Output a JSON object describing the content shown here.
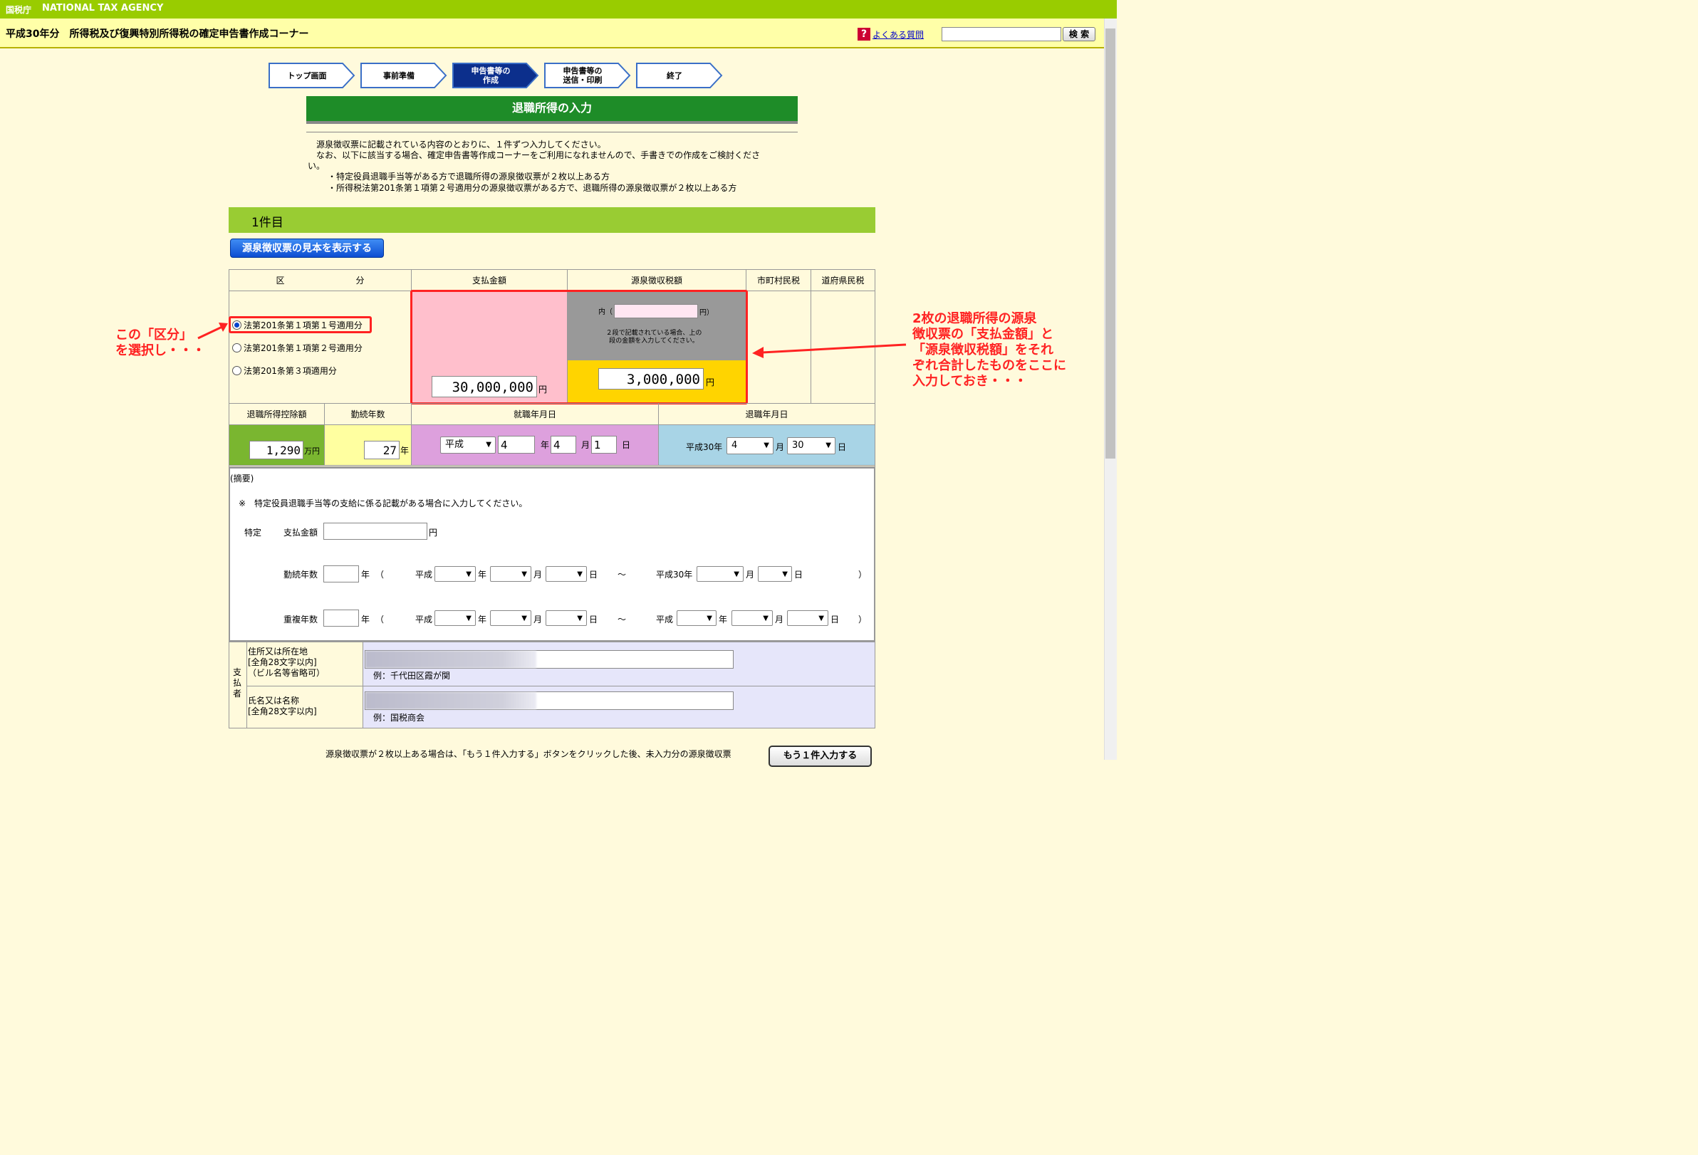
{
  "header": {
    "agency_kanji": "国税庁",
    "agency_en": "NATIONAL TAX AGENCY",
    "title": "平成30年分　所得税及び復興特別所得税の確定申告書作成コーナー",
    "faq_icon": "?",
    "faq_link": "よくある質問",
    "search_button": "検 索"
  },
  "steps": [
    {
      "label": "トップ画面"
    },
    {
      "label": "事前準備"
    },
    {
      "label": "申告書等の\n作成"
    },
    {
      "label": "申告書等の\n送信・印刷"
    },
    {
      "label": "終了"
    }
  ],
  "section_title": "退職所得の入力",
  "notes": {
    "line1": "源泉徴収票に記載されている内容のとおりに、１件ずつ入力してください。",
    "line2": "なお、以下に該当する場合、確定申告書等作成コーナーをご利用になれませんので、手書きでの作成をご検討くださ",
    "line3": "い。",
    "bullet1": "・特定役員退職手当等がある方で退職所得の源泉徴収票が２枚以上ある方",
    "bullet2": "・所得税法第201条第１項第２号適用分の源泉徴収票がある方で、退職所得の源泉徴収票が２枚以上ある方"
  },
  "item_label": "1件目",
  "sample_button": "源泉徴収票の見本を表示する",
  "table": {
    "headers": {
      "kubun_1": "区",
      "kubun_2": "分",
      "payment": "支払金額",
      "withholding": "源泉徴収税額",
      "municipal": "市町村民税",
      "prefectural": "道府県民税"
    },
    "radios": [
      {
        "label": "法第201条第１項第１号適用分",
        "checked": true
      },
      {
        "label": "法第201条第１項第２号適用分",
        "checked": false
      },
      {
        "label": "法第201条第３項適用分",
        "checked": false
      }
    ],
    "inner_prefix": "内（",
    "inner_suffix": "円）",
    "two_line_note": "２段で記載されている場合、上の\n段の金額を入力してください。",
    "payment_value": "30,000,000",
    "withholding_value": "3,000,000",
    "yen": "円",
    "headers2": {
      "deduction": "退職所得控除額",
      "years": "勤続年数",
      "join_date": "就職年月日",
      "retire_date": "退職年月日"
    },
    "deduction_value": "1,290",
    "deduction_unit": "万円",
    "years_value": "27",
    "years_unit": "年",
    "join_era": "平成",
    "join_year": "4",
    "join_month": "4",
    "join_day": "1",
    "unit_year": "年",
    "unit_month": "月",
    "unit_day": "日",
    "retire_era_label": "平成30年",
    "retire_month": "4",
    "retire_day": "30"
  },
  "summary": {
    "title": "(摘要)",
    "note": "※　特定役員退職手当等の支給に係る記載がある場合に入力してください。",
    "tokutei": "特定",
    "payment_label": "支払金額",
    "yen": "円",
    "years_label": "勤続年数",
    "overlap_label": "重複年数",
    "nen": "年",
    "open_paren": "（",
    "close_paren": "）",
    "era": "平成",
    "era30": "平成30年",
    "tsuki": "月",
    "hi": "日",
    "tilde": "〜"
  },
  "payer": {
    "side_label": "支\n払\n者",
    "address_label": "住所又は所在地\n[全角28文字以内]\n（ビル名等省略可）",
    "address_example": "例：千代田区霞が関",
    "name_label": "氏名又は名称\n[全角28文字以内]",
    "name_example": "例：国税商会"
  },
  "footer": {
    "note": "源泉徴収票が２枚以上ある場合は、「もう１件入力する」ボタンをクリックした後、未入力分の源泉徴収票",
    "button": "もう１件入力する"
  },
  "annotations": {
    "left": "この「区分」\nを選択し・・・",
    "right": "2枚の退職所得の源泉\n徴収票の「支払金額」と\n「源泉徴収税額」をそれ\nぞれ合計したものをここに\n入力しておき・・・"
  },
  "colors": {
    "accent_red": "#ff2222",
    "header_green": "#99cc00",
    "section_green": "#1e8c28"
  }
}
